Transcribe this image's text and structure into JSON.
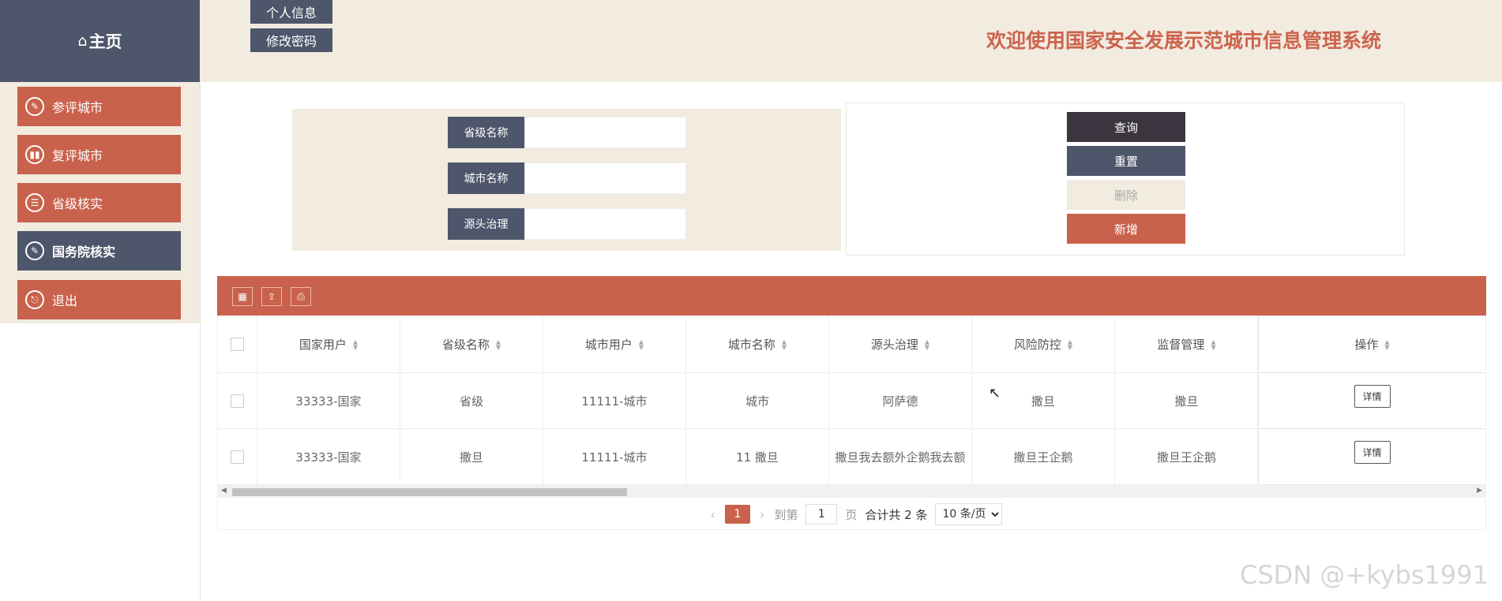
{
  "header": {
    "logo_label": "主页",
    "logo_icon": "home-icon",
    "personal_info": "个人信息",
    "change_password": "修改密码",
    "welcome": "欢迎使用国家安全发展示范城市信息管理系统"
  },
  "sidebar": {
    "items": [
      {
        "label": "参评城市",
        "icon": "edit-icon"
      },
      {
        "label": "复评城市",
        "icon": "bar-chart-icon"
      },
      {
        "label": "省级核实",
        "icon": "clipboard-icon"
      },
      {
        "label": "国务院核实",
        "icon": "edit-icon",
        "active": true
      },
      {
        "label": "退出",
        "icon": "logout-icon"
      }
    ]
  },
  "search": {
    "province_label": "省级名称",
    "city_label": "城市名称",
    "source_label": "源头治理",
    "province_value": "",
    "city_value": "",
    "source_value": ""
  },
  "actions": {
    "query": "查询",
    "reset": "重置",
    "delete": "删除",
    "add": "新增"
  },
  "toolbar": {
    "icons": [
      "columns-icon",
      "export-icon",
      "print-icon"
    ]
  },
  "table": {
    "headers": [
      "国家用户",
      "省级名称",
      "城市用户",
      "城市名称",
      "源头治理",
      "风险防控",
      "监督管理",
      "操作"
    ],
    "rows": [
      [
        "33333-国家",
        "省级",
        "11111-城市",
        "城市",
        "阿萨德",
        "撒旦",
        "撒旦",
        "详情"
      ],
      [
        "33333-国家",
        "撒旦",
        "11111-城市",
        "11 撒旦",
        "撒旦我去额外企鹅我去额",
        "撒旦王企鹅",
        "撒旦王企鹅",
        "详情"
      ]
    ]
  },
  "pagination": {
    "current": "1",
    "goto_label": "到第",
    "goto_value": "1",
    "page_suffix": "页",
    "total": "合计共 2 条",
    "page_size": "10 条/页"
  },
  "watermark": "CSDN @+kybs1991",
  "colors": {
    "accent": "#c9624c",
    "dark": "#4e566b",
    "beige": "#f1ebe0",
    "title": "#cc634d"
  }
}
